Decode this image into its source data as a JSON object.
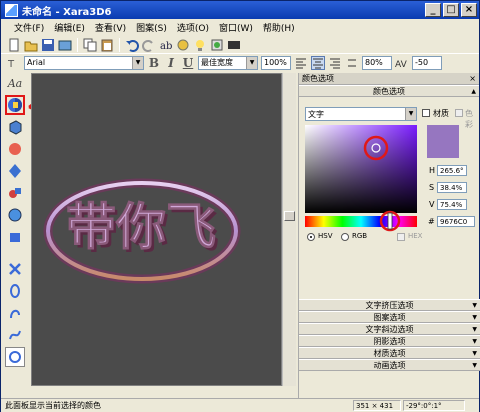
{
  "window": {
    "title": "未命名 - Xara3D6"
  },
  "menus": [
    "文件(F)",
    "编辑(E)",
    "查看(V)",
    "图案(S)",
    "选项(O)",
    "窗口(W)",
    "帮助(H)"
  ],
  "toolbar2": {
    "font": "Arial",
    "bold": "B",
    "italic": "I",
    "underline": "U",
    "width_mode": "最佳宽度",
    "zoom": "100%",
    "line_spacing": "80%",
    "kerning": "-50"
  },
  "left_tools": {
    "text_tool": "Aa"
  },
  "canvas": {
    "text": "带你飞",
    "background_color": "#4b4b4b"
  },
  "panel": {
    "title": "颜色选项",
    "section_top": "颜色选项",
    "target_select": "文字",
    "material_label": "材质",
    "shadow_label": "色彩",
    "h_label": "H",
    "h_value": "265.6°",
    "s_label": "S",
    "s_value": "38.4%",
    "v_label": "V",
    "v_value": "75.4%",
    "hex_label": "#",
    "hex_value": "9676C0",
    "hsv_label": "HSV",
    "rgb_label": "RGB",
    "hex_check_label": "HEX",
    "current_color": "#9676c0",
    "sections": [
      "文字挤压选项",
      "图案选项",
      "文字斜边选项",
      "阴影选项",
      "材质选项",
      "动画选项"
    ]
  },
  "status": {
    "text": "此面板显示当前选择的颜色",
    "size": "351 × 431",
    "rotation": "-29°:0°:1°"
  },
  "colors": {
    "highlight_red": "#e01818",
    "title_blue": "#0a3bb0"
  }
}
